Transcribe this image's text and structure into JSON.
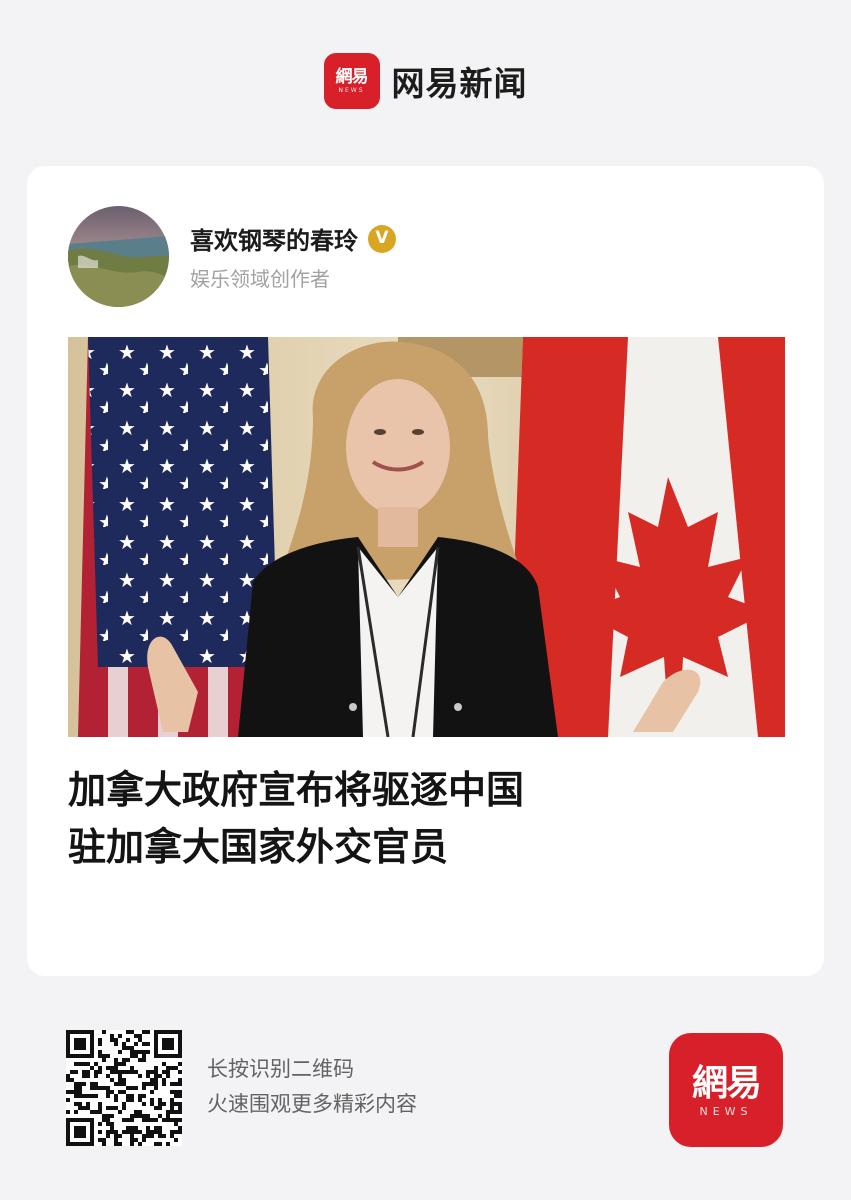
{
  "brand": {
    "logo_text": "網易",
    "logo_sub": "NEWS",
    "name": "网易新闻"
  },
  "author": {
    "name": "喜欢钢琴的春玲",
    "role": "娱乐领域创作者",
    "verified_badge": "V"
  },
  "article": {
    "headline_line1": "加拿大政府宣布将驱逐中国",
    "headline_line2": "驻加拿大国家外交官员"
  },
  "footer": {
    "qr_line1": "长按识别二维码",
    "qr_line2": "火速围观更多精彩内容",
    "logo_text": "網易",
    "logo_sub": "NEWS"
  },
  "colors": {
    "brand_red": "#d8202a",
    "verified_gold": "#d9a623",
    "background": "#f3f3f5"
  },
  "icons": [
    "netease-logo-icon",
    "verified-icon",
    "qr-code-icon"
  ]
}
